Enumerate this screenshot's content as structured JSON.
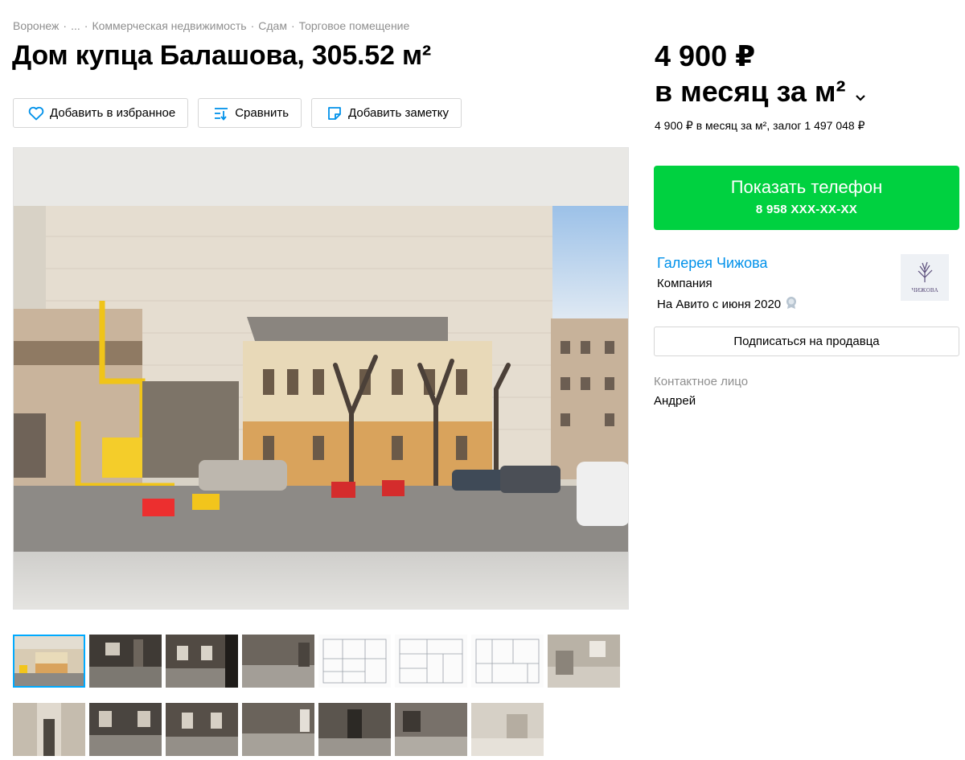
{
  "breadcrumb": [
    "Воронеж",
    "...",
    "Коммерческая недвижимость",
    "Сдам",
    "Торговое помещение"
  ],
  "title": "Дом купца Балашова, 305.52 м²",
  "actions": {
    "favorite": "Добавить в избранное",
    "compare": "Сравнить",
    "note": "Добавить заметку"
  },
  "price": {
    "amount": "4 900 ₽",
    "unit": "в месяц за м²",
    "details": "4 900 ₽ в месяц за м², залог 1 497 048 ₽"
  },
  "phone_button": {
    "label": "Показать телефон",
    "number": "8 958 XXX-XX-XX"
  },
  "seller": {
    "name": "Галерея Чижова",
    "type": "Компания",
    "since": "На Авито с июня 2020",
    "logo_text": "ЧИЖОВА"
  },
  "subscribe_button": "Подписаться на продавца",
  "contact": {
    "label": "Контактное лицо",
    "name": "Андрей"
  },
  "colors": {
    "accent_green": "#00d140",
    "link_blue": "#0091ea",
    "thumb_selected": "#00aaff"
  }
}
